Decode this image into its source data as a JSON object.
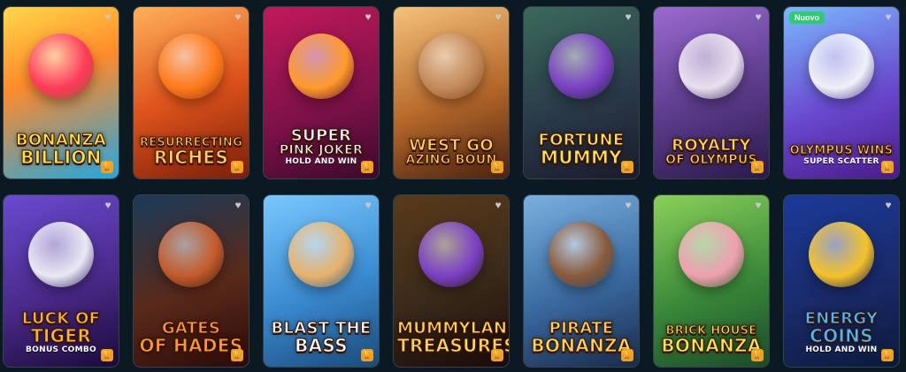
{
  "games": [
    {
      "id": "bonanza-billion",
      "line1": "Bonanza",
      "line2": "Billion",
      "sub": "",
      "badge": "",
      "fav": "♥",
      "trophy": "🏆",
      "bg": "linear-gradient(160deg,#ffd84a 0%,#ff8a2a 40%,#22a7e0 100%)",
      "color": "#ffe23a",
      "figure": "#ff3b5a"
    },
    {
      "id": "resurrecting-riches",
      "line1": "Resurrecting",
      "line2": "Riches",
      "sub": "",
      "badge": "",
      "fav": "♥",
      "trophy": "🏆",
      "bg": "linear-gradient(160deg,#ffb05a 0%,#e0541c 50%,#7a1e0a 100%)",
      "color": "#ffcf5a",
      "figure": "#ff7a1a"
    },
    {
      "id": "super-pink-joker",
      "line1": "Super",
      "line2": "Pink Joker",
      "sub": "Hold and Win",
      "badge": "",
      "fav": "♥",
      "trophy": "🏆",
      "bg": "linear-gradient(160deg,#c2185b 0%,#7b1148 60%,#3a0a2a 100%)",
      "color": "#ffffff",
      "figure": "#ff9a2a"
    },
    {
      "id": "wild-west-gold",
      "line1": "West Go",
      "line2": "azing Boun",
      "sub": "",
      "badge": "",
      "fav": "♥",
      "trophy": "🏆",
      "bg": "linear-gradient(160deg,#f5c27a 0%,#b5672a 55%,#4a2210 100%)",
      "color": "#ffd45a",
      "figure": "#c48a5a"
    },
    {
      "id": "fortune-mummy",
      "line1": "Fortune",
      "line2": "Mummy",
      "sub": "",
      "badge": "",
      "fav": "♥",
      "trophy": "🏆",
      "bg": "linear-gradient(160deg,#3a6a5a 0%,#2a3a4a 55%,#1a1a2a 100%)",
      "color": "#ffe14a",
      "figure": "#7b3fc4"
    },
    {
      "id": "royalty-of-olympus",
      "line1": "Royalty",
      "line2": "of Olympus",
      "sub": "",
      "badge": "",
      "fav": "♥",
      "trophy": "🏆",
      "bg": "linear-gradient(160deg,#9a6ad0 0%,#5a3a8a 55%,#2a1a4a 100%)",
      "color": "#ffd54a",
      "figure": "#e8e0f0"
    },
    {
      "id": "olympus-wins",
      "line1": "Olympus Wins",
      "line2": "",
      "sub": "Super Scatter",
      "badge": "Nuovo",
      "fav": "♥",
      "trophy": "🏆",
      "bg": "linear-gradient(160deg,#7ab8ff 0%,#6a4ad0 55%,#4a1a8a 100%)",
      "color": "#ffd54a",
      "figure": "#f0f0f8"
    },
    {
      "id": "luck-of-tiger",
      "line1": "Luck of",
      "line2": "Tiger",
      "sub": "Bonus Combo",
      "badge": "",
      "fav": "♥",
      "trophy": "🏆",
      "bg": "linear-gradient(160deg,#6a4ad0 0%,#4a2a8a 55%,#1a0a3a 100%)",
      "color": "#ffb52a",
      "figure": "#e8e8f5"
    },
    {
      "id": "gates-of-hades",
      "line1": "Gates",
      "line2": "of Hades",
      "sub": "",
      "badge": "",
      "fav": "♥",
      "trophy": "🏆",
      "bg": "linear-gradient(160deg,#1a3a5a 0%,#5a2a1a 55%,#2a0a0a 100%)",
      "color": "#ff9a2a",
      "figure": "#c45a2a"
    },
    {
      "id": "blast-the-bass",
      "line1": "Blast the",
      "line2": "Bass",
      "sub": "",
      "badge": "",
      "fav": "♥",
      "trophy": "🏆",
      "bg": "linear-gradient(160deg,#7ac8ff 0%,#3a8ad0 55%,#1a4a7a 100%)",
      "color": "#ffffff",
      "figure": "#e8b26a"
    },
    {
      "id": "mummyland-treasures",
      "line1": "Mummyland",
      "line2": "Treasures",
      "sub": "",
      "badge": "",
      "fav": "♥",
      "trophy": "🏆",
      "bg": "linear-gradient(160deg,#5a3a1a 0%,#3a2a1a 55%,#1a0a0a 100%)",
      "color": "#ffd54a",
      "figure": "#7b3fc4"
    },
    {
      "id": "pirate-bonanza",
      "line1": "Pirate",
      "line2": "Bonanza",
      "sub": "",
      "badge": "",
      "fav": "♥",
      "trophy": "🏆",
      "bg": "linear-gradient(160deg,#7ab0e0 0%,#3a6aa0 55%,#1a2a4a 100%)",
      "color": "#ffd54a",
      "figure": "#8a5a3a"
    },
    {
      "id": "brick-house-bonanza",
      "line1": "Brick House",
      "line2": "Bonanza",
      "sub": "",
      "badge": "",
      "fav": "♥",
      "trophy": "🏆",
      "bg": "linear-gradient(160deg,#8ad05a 0%,#3a8a3a 55%,#1a4a2a 100%)",
      "color": "#ffe14a",
      "figure": "#f0a0b0"
    },
    {
      "id": "energy-coins",
      "line1": "Energy",
      "line2": "Coins",
      "sub": "Hold and Win",
      "badge": "",
      "fav": "♥",
      "trophy": "🏆",
      "bg": "linear-gradient(160deg,#1a3a9a 0%,#1a2a6a 55%,#0a1a3a 100%)",
      "color": "#4ab8ff",
      "figure": "#f5c22a"
    }
  ]
}
